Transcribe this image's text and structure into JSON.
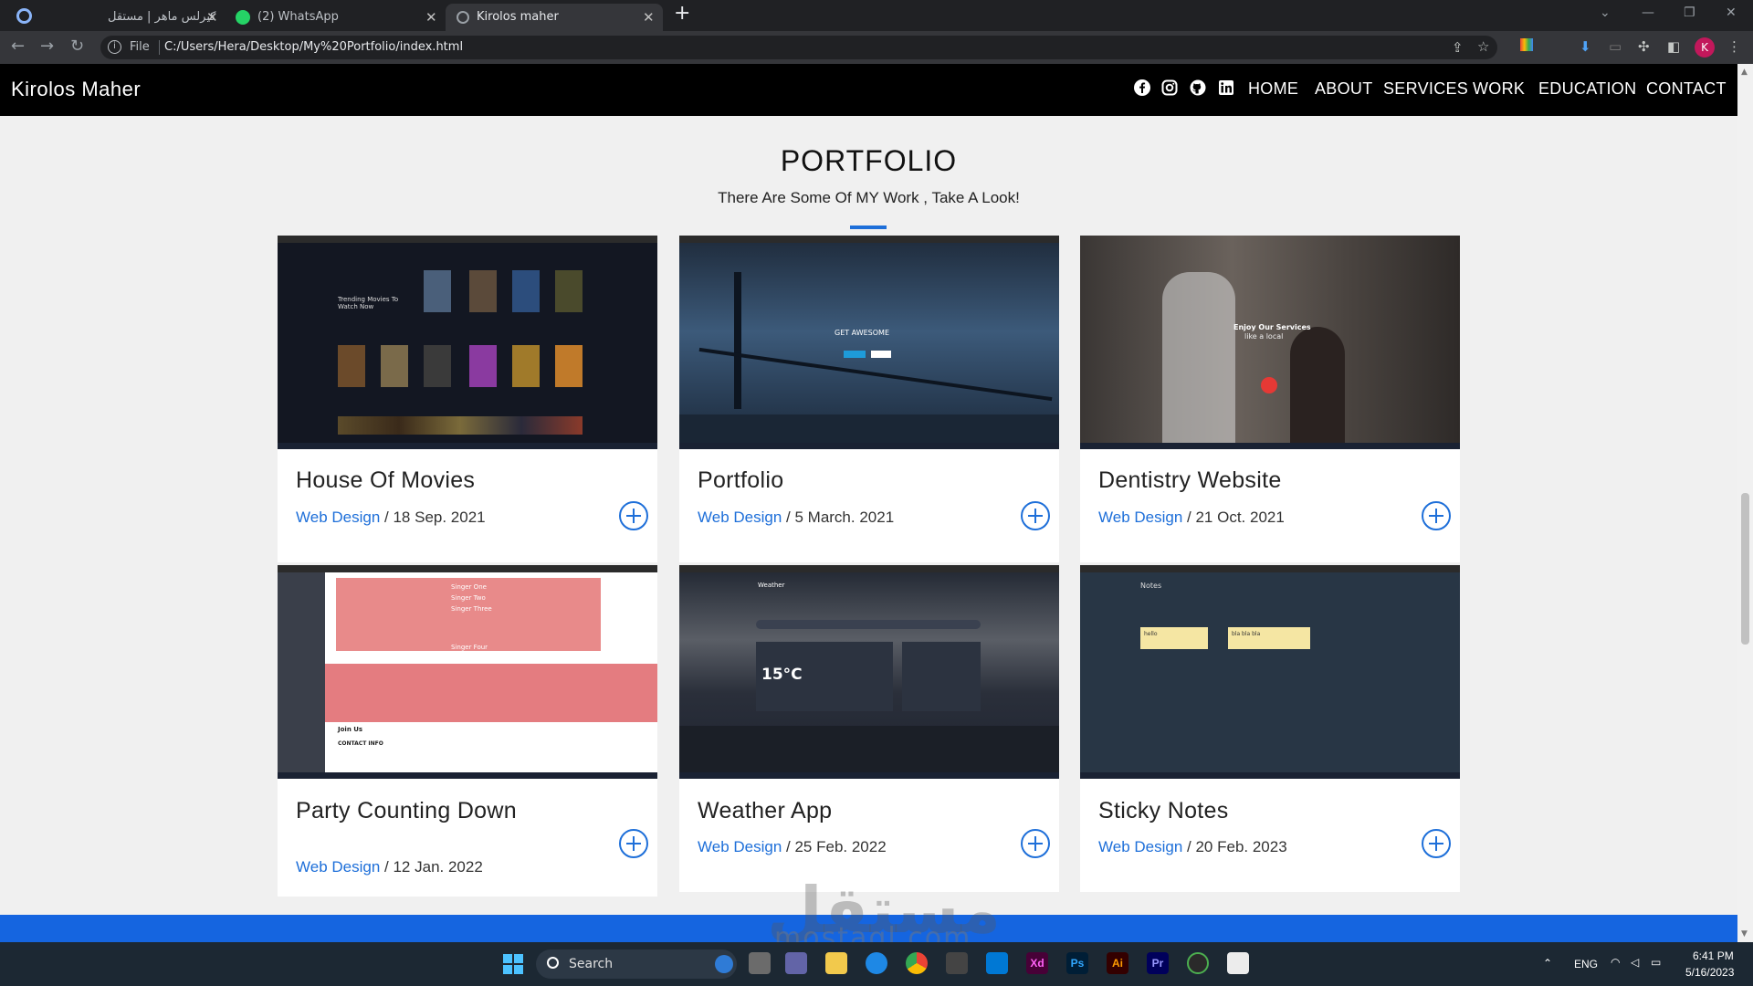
{
  "browser": {
    "tabs": [
      {
        "title": "كيرلس ماهر | مستقل"
      },
      {
        "title": "(2) WhatsApp"
      },
      {
        "title": "Kirolos maher"
      }
    ],
    "new_tab": "+",
    "omnibox": {
      "scheme": "File",
      "url": "C:/Users/Hera/Desktop/My%20Portfolio/index.html"
    },
    "profile_initial": "K"
  },
  "site": {
    "brand": "Kirolos Maher",
    "social": [
      "facebook-icon",
      "instagram-icon",
      "github-icon",
      "linkedin-icon"
    ],
    "menu": [
      "HOME",
      "ABOUT",
      "SERVICES",
      "WORK",
      "EDUCATION",
      "CONTACT"
    ]
  },
  "portfolio": {
    "title": "PORTFOLIO",
    "subtitle": "There Are Some Of MY Work , Take A Look!",
    "cards": [
      {
        "title": "House Of Movies",
        "category": "Web Design",
        "date": "/ 18 Sep. 2021"
      },
      {
        "title": "Portfolio",
        "category": "Web Design",
        "date": "/ 5 March. 2021"
      },
      {
        "title": "Dentistry Website",
        "category": "Web Design",
        "date": "/ 21 Oct. 2021"
      },
      {
        "title": "Party Counting Down",
        "category": "Web Design",
        "date": "/ 12 Jan. 2022"
      },
      {
        "title": "Weather App",
        "category": "Web Design",
        "date": "/ 25 Feb. 2022"
      },
      {
        "title": "Sticky Notes",
        "category": "Web Design",
        "date": "/ 20 Feb. 2023"
      }
    ],
    "thumbs": {
      "movies": {
        "heading": "Trending Movies To Watch Now"
      },
      "bridge": {
        "heading": "GET AWESOME"
      },
      "dentist": {
        "heading": "Enjoy Our Services",
        "sub": "like a local"
      },
      "party": {
        "rows": [
          "Singer One",
          "Singer Two",
          "Singer Three",
          "Singer Four"
        ],
        "join": "Join Us",
        "contact": "CONTACT INFO"
      },
      "weather": {
        "temp": "15°C",
        "app": "Weather"
      },
      "notes": {
        "heading": "Notes",
        "note1": "hello",
        "note2": "bla bla bla"
      }
    }
  },
  "watermark": {
    "arabic": "مستقل",
    "latin": "mostaql.com"
  },
  "taskbar": {
    "search": "Search",
    "lang": "ENG",
    "time": "6:41 PM",
    "date": "5/16/2023",
    "apps": [
      "Xd",
      "Ps",
      "Ai",
      "Pr"
    ]
  }
}
